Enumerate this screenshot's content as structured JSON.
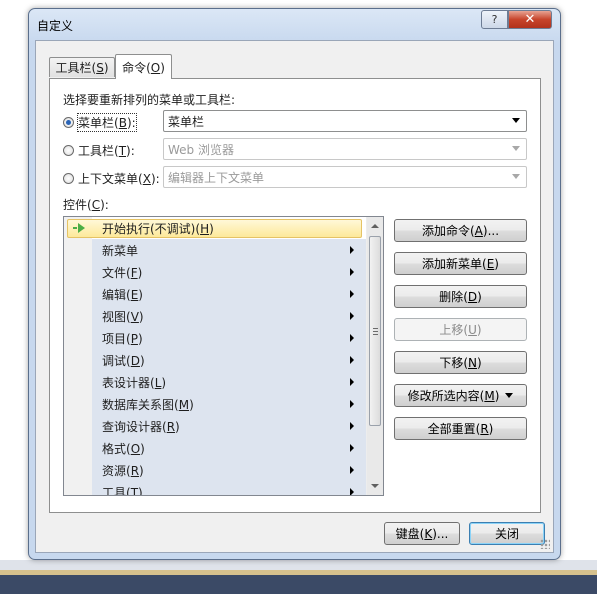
{
  "window": {
    "title": "自定义",
    "help_label": "?",
    "close_label": "✕"
  },
  "tabs": [
    {
      "label": "工具栏",
      "key": "S"
    },
    {
      "label": "命令",
      "key": "O"
    }
  ],
  "prompt": "选择要重新排列的菜单或工具栏:",
  "options": [
    {
      "label": "菜单栏",
      "key": "B",
      "selected": true,
      "combo_value": "菜单栏",
      "enabled": true
    },
    {
      "label": "工具栏",
      "key": "T",
      "selected": false,
      "combo_value": "Web 浏览器",
      "enabled": false
    },
    {
      "label": "上下文菜单",
      "key": "X",
      "selected": false,
      "combo_value": "编辑器上下文菜单",
      "enabled": false
    }
  ],
  "controls_label": {
    "text": "控件",
    "key": "C"
  },
  "controls": [
    {
      "text": "开始执行(不调试)",
      "key": "H",
      "icon": "play-icon",
      "submenu": false,
      "selected": true
    },
    {
      "text": "新菜单",
      "key": "",
      "submenu": true
    },
    {
      "text": "文件",
      "key": "F",
      "submenu": true
    },
    {
      "text": "编辑",
      "key": "E",
      "submenu": true
    },
    {
      "text": "视图",
      "key": "V",
      "submenu": true
    },
    {
      "text": "项目",
      "key": "P",
      "submenu": true
    },
    {
      "text": "调试",
      "key": "D",
      "submenu": true
    },
    {
      "text": "表设计器",
      "key": "L",
      "submenu": true
    },
    {
      "text": "数据库关系图",
      "key": "M",
      "submenu": true
    },
    {
      "text": "查询设计器",
      "key": "R",
      "submenu": true
    },
    {
      "text": "格式",
      "key": "O",
      "submenu": true
    },
    {
      "text": "资源",
      "key": "R",
      "submenu": true
    },
    {
      "text": "工具",
      "key": "T",
      "submenu": true
    }
  ],
  "buttons": {
    "add_command": {
      "text": "添加命令",
      "key": "A",
      "suffix": "..."
    },
    "add_menu": {
      "text": "添加新菜单",
      "key": "E",
      "suffix": ""
    },
    "delete": {
      "text": "删除",
      "key": "D",
      "suffix": ""
    },
    "move_up": {
      "text": "上移",
      "key": "U",
      "suffix": ""
    },
    "move_down": {
      "text": "下移",
      "key": "N",
      "suffix": ""
    },
    "modify": {
      "text": "修改所选内容",
      "key": "M",
      "suffix": ""
    },
    "reset_all": {
      "text": "全部重置",
      "key": "R",
      "suffix": ""
    },
    "keyboard": {
      "text": "键盘",
      "key": "K",
      "suffix": "..."
    },
    "close": {
      "text": "关闭"
    }
  },
  "colors": {
    "accent": "#2a64b6",
    "selection": "#fde99a",
    "item_bg": "#dde4ef"
  }
}
